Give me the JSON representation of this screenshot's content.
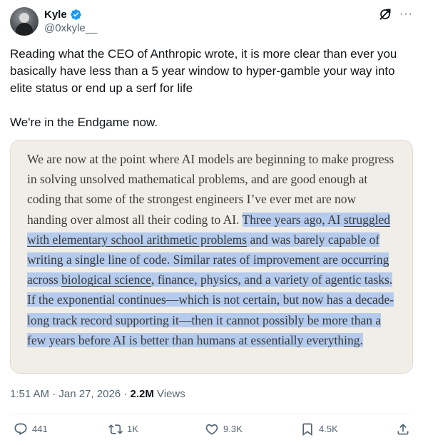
{
  "author": {
    "name": "Kyle",
    "handle": "@0xkyle__",
    "verified": true,
    "verified_color": "#1d9bf0"
  },
  "tweet": {
    "text": "Reading what the CEO of Anthropic wrote, it is more clear than ever you basically have less than a 5 year window to hyper-gamble your way into elite status or end up a serf for life\n\nWe're in the Endgame now."
  },
  "quote": {
    "part1": "We are now at the point where AI models are beginning to make progress in solving unsolved mathematical problems, and are good enough at coding that some of the strongest engineers I’ve ever met are now handing over almost all their coding to AI. ",
    "part2": "Three years ago, AI ",
    "link1": "struggled with elementary school arithmetic problems",
    "part3": " and was barely capable of writing a single line of code. Similar rates of improvement are occurring across ",
    "link2": "biological science",
    "part4": ", finance, physics, and a variety of agentic tasks. If the exponential continues—which is not certain, but now has a decade-long track record supporting it—then it cannot possibly be more than a few years before AI is better than humans at essentially everything.",
    "highlight_color": "#b5cbee",
    "card_background": "#f0eee6"
  },
  "meta": {
    "time": "1:51 AM",
    "separator": "·",
    "date": "Jan 27, 2026",
    "views_count": "2.2M",
    "views_label": "Views"
  },
  "actions": {
    "replies": "441",
    "reposts": "1K",
    "likes": "9.3K",
    "bookmarks": "4.5K"
  },
  "icons": {
    "verified": "verified-badge-icon",
    "grok": "grok-icon",
    "more": "more-options-icon",
    "reply": "reply-icon",
    "repost": "repost-icon",
    "like": "heart-icon",
    "bookmark": "bookmark-icon",
    "share": "share-icon"
  }
}
